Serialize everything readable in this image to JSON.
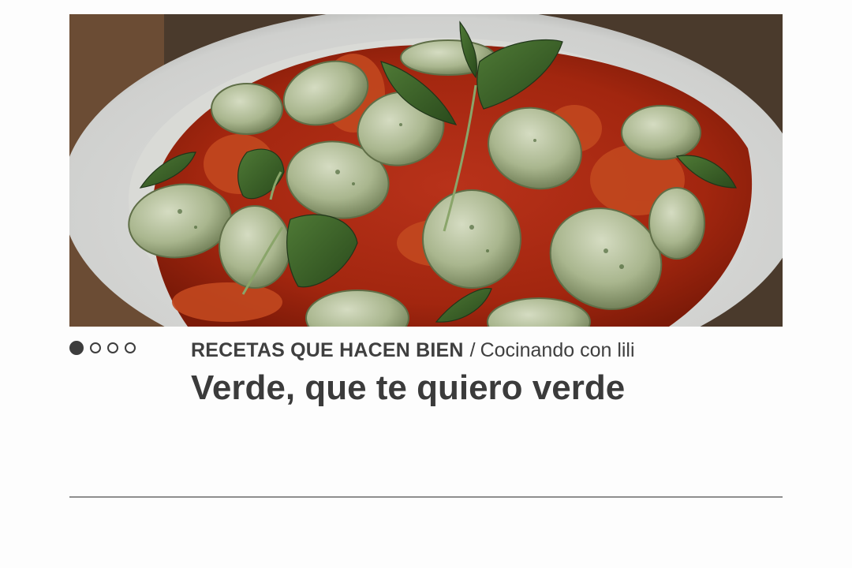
{
  "slider": {
    "image_alt": "Ñoquis verdes con salsa de tomate y hojas de albahaca",
    "dots": [
      {
        "state": "active"
      },
      {
        "state": "inactive"
      },
      {
        "state": "inactive"
      },
      {
        "state": "inactive"
      }
    ]
  },
  "article": {
    "section": "RECETAS QUE HACEN BIEN",
    "separator": "/",
    "author": "Cocinando con lili",
    "title": "Verde, que te quiero verde"
  },
  "colors": {
    "text": "#3d3d3d",
    "rule": "#8e8e8e",
    "background": "#fdfdfd"
  }
}
